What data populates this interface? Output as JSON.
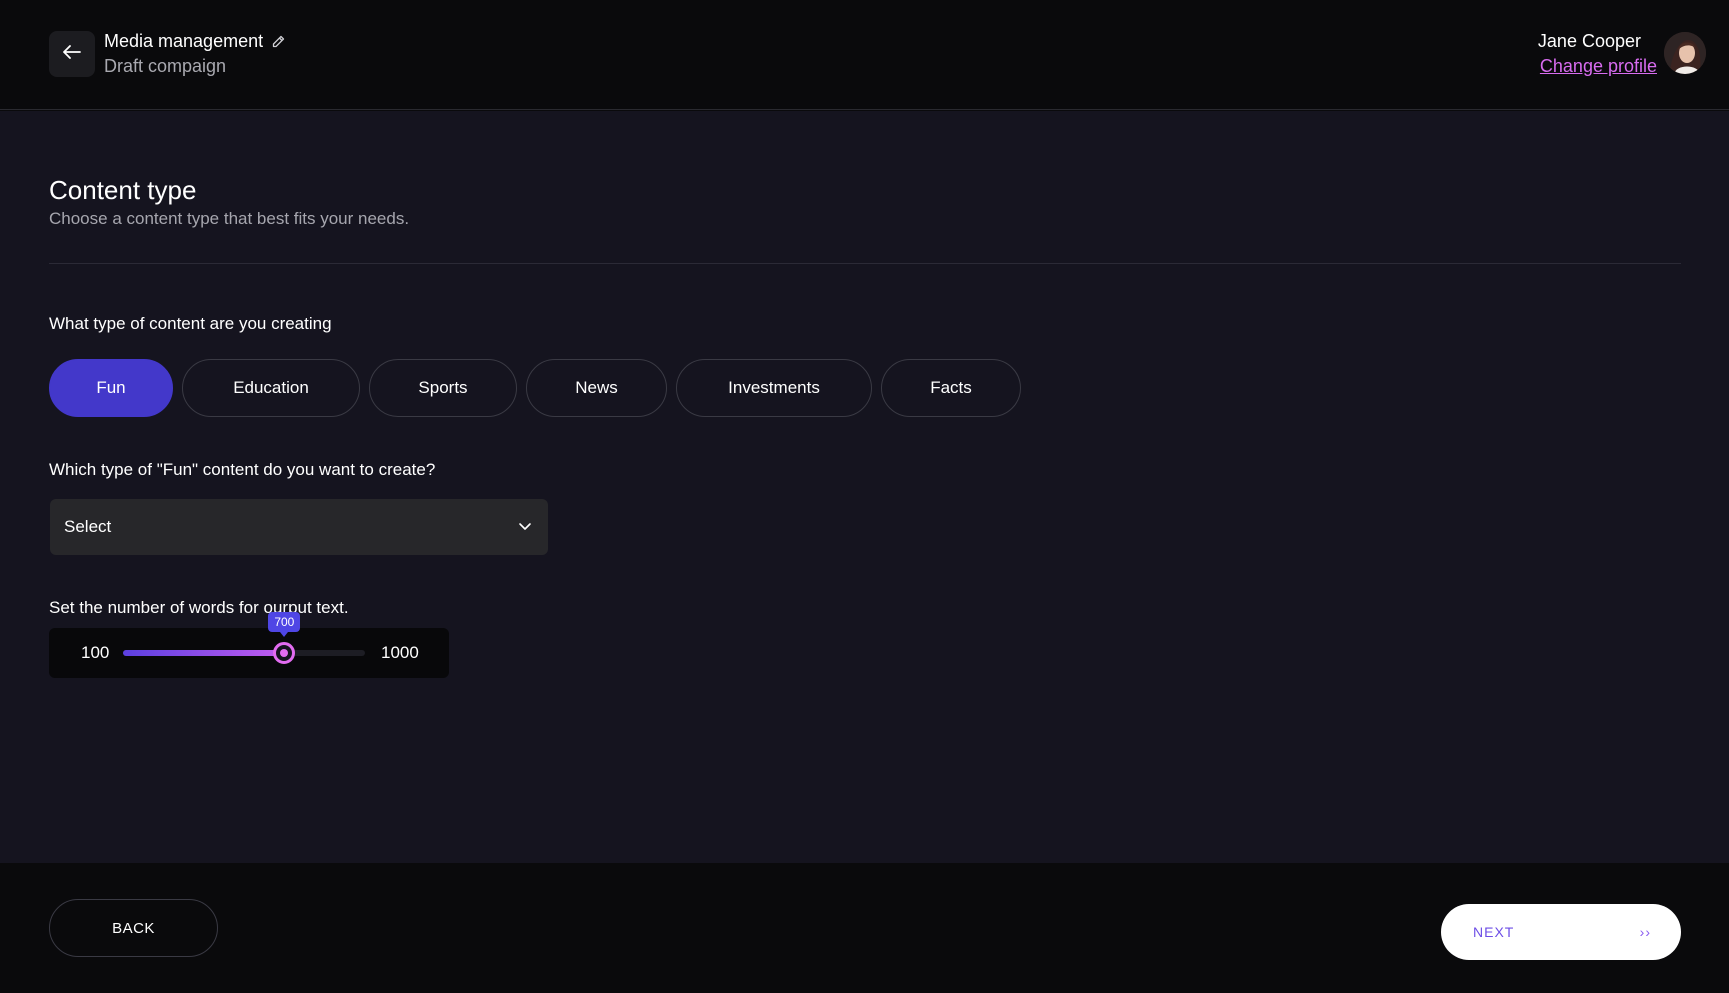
{
  "header": {
    "title": "Media management",
    "subtitle": "Draft compaign",
    "user_name": "Jane Cooper",
    "change_profile": "Change profile"
  },
  "main": {
    "title": "Content type",
    "subtitle": "Choose a content type that best fits your needs.",
    "question_type": "What type of content are you creating",
    "content_types": [
      {
        "label": "Fun",
        "selected": true
      },
      {
        "label": "Education",
        "selected": false
      },
      {
        "label": "Sports",
        "selected": false
      },
      {
        "label": "News",
        "selected": false
      },
      {
        "label": "Investments",
        "selected": false
      },
      {
        "label": "Facts",
        "selected": false
      }
    ],
    "question_subtype": "Which type of \"Fun\" content do you want to create?",
    "select_value": "Select",
    "question_words": "Set the number of words for ourput text.",
    "slider": {
      "min": 100,
      "max": 1000,
      "value": 700
    }
  },
  "footer": {
    "back_label": "BACK",
    "next_label": "NEXT",
    "next_icon": "››"
  },
  "colors": {
    "accent": "#4338ca",
    "link": "#d86cf0",
    "slider_thumb": "#e26cf0"
  },
  "icons": {
    "back": "arrow-left-icon",
    "edit": "pencil-icon",
    "dropdown": "chevron-down-icon",
    "next": "double-chevron-right-icon"
  }
}
